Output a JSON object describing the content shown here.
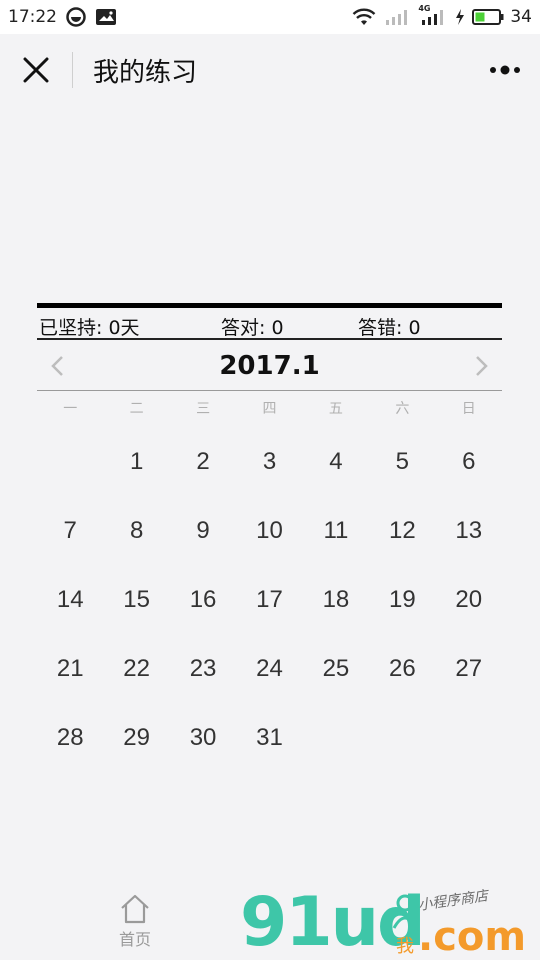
{
  "status_bar": {
    "time": "17:22",
    "battery": "34",
    "network_label": "4G",
    "accent_green": "#4cd137"
  },
  "nav": {
    "title": "我的练习"
  },
  "stats": {
    "streak": "已坚持: 0天",
    "correct": "答对: 0",
    "wrong": "答错: 0"
  },
  "calendar": {
    "title": "2017.1",
    "weekdays": [
      "一",
      "二",
      "三",
      "四",
      "五",
      "六",
      "日"
    ],
    "days": [
      "",
      "1",
      "2",
      "3",
      "4",
      "5",
      "6",
      "7",
      "8",
      "9",
      "10",
      "11",
      "12",
      "13",
      "14",
      "15",
      "16",
      "17",
      "18",
      "19",
      "20",
      "21",
      "22",
      "23",
      "24",
      "25",
      "26",
      "27",
      "28",
      "29",
      "30",
      "31",
      "",
      "",
      ""
    ]
  },
  "tabbar": {
    "home_label": "首页"
  },
  "watermark": {
    "brand": "91ud",
    "me": "我",
    "com": ".com",
    "tagline": "小程序商店"
  }
}
